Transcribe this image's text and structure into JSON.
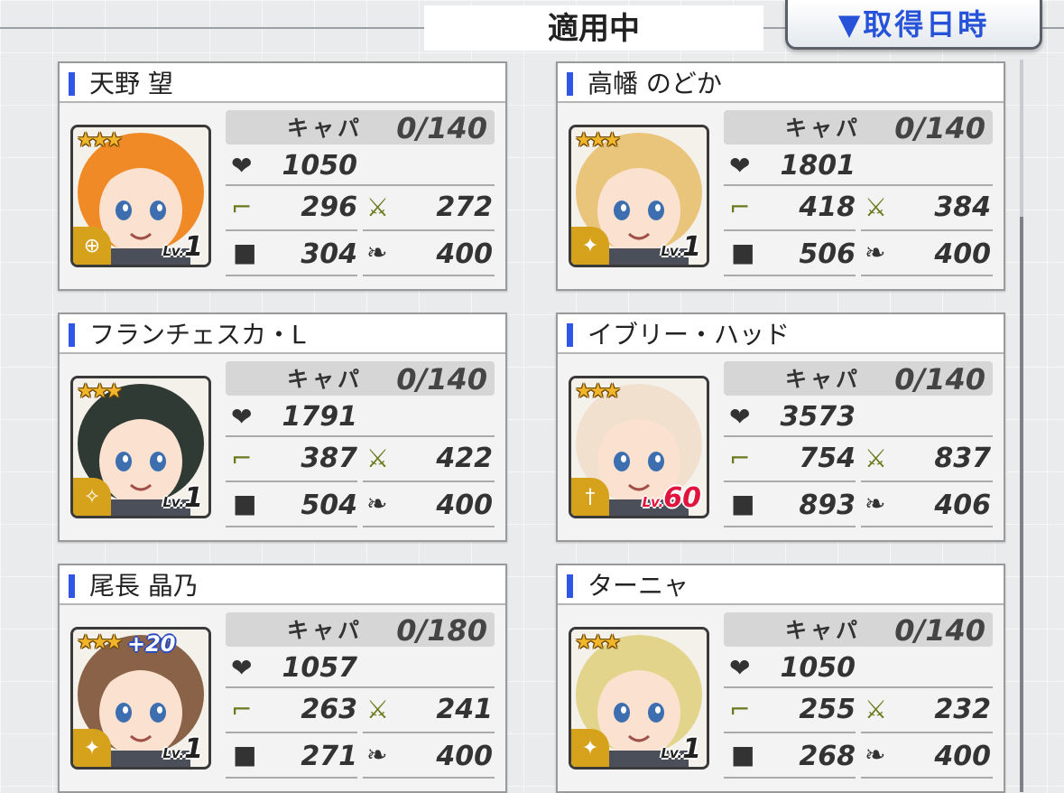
{
  "header": {
    "title": "適用中",
    "sort_label": "▼取得日時"
  },
  "labels": {
    "capa": "キャパ",
    "lv": "Lv."
  },
  "icons": {
    "hp": "heart-icon",
    "attack": "gun-icon",
    "defense": "shield-icon",
    "accuracy": "sword-icon",
    "evasion": "wing-icon"
  },
  "cards": [
    {
      "name": "天野 望",
      "capa": "0/140",
      "hp": "1050",
      "atk": "296",
      "acc": "272",
      "def": "304",
      "eva": "400",
      "level": "1",
      "stars": "★★★",
      "plus": "",
      "role": "target-icon",
      "hair": "#f08a26"
    },
    {
      "name": "高幡 のどか",
      "capa": "0/140",
      "hp": "1801",
      "atk": "418",
      "acc": "384",
      "def": "506",
      "eva": "400",
      "level": "1",
      "stars": "★★★",
      "plus": "",
      "role": "rifle-icon",
      "hair": "#e9c57c"
    },
    {
      "name": "フランチェスカ・L",
      "capa": "0/140",
      "hp": "1791",
      "atk": "387",
      "acc": "422",
      "def": "504",
      "eva": "400",
      "level": "1",
      "stars": "★★★",
      "plus": "",
      "role": "gun-icon",
      "hair": "#2f3a34"
    },
    {
      "name": "イブリー・ハッド",
      "capa": "0/140",
      "hp": "3573",
      "atk": "754",
      "acc": "837",
      "def": "893",
      "eva": "406",
      "level": "60",
      "stars": "★★★",
      "plus": "",
      "role": "sword-icon",
      "hair": "#f2e0cf"
    },
    {
      "name": "尾長 晶乃",
      "capa": "0/180",
      "hp": "1057",
      "atk": "263",
      "acc": "241",
      "def": "271",
      "eva": "400",
      "level": "1",
      "stars": "★★★",
      "plus": "+20",
      "role": "rifle-icon",
      "hair": "#8a6248"
    },
    {
      "name": "ターニャ",
      "capa": "0/140",
      "hp": "1050",
      "atk": "255",
      "acc": "232",
      "def": "268",
      "eva": "400",
      "level": "1",
      "stars": "★★★",
      "plus": "",
      "role": "rifle-icon",
      "hair": "#e2d48a"
    }
  ]
}
